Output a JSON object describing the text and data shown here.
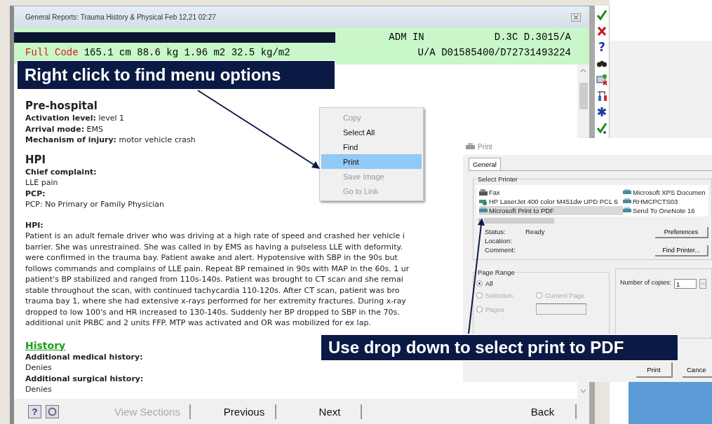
{
  "window": {
    "title": "General Reports:  Trauma History & Physical  Feb 12,21 02:27"
  },
  "banner": {
    "admission": "ADM IN",
    "location": "D.3C D.3015/A",
    "code_status": "Full Code",
    "measurements": "165.1 cm 88.6 kg  1.96 m2  32.5 kg/m2",
    "account": "U/A D01585400/D72731493224"
  },
  "callouts": [
    "Right click to find menu options",
    "Use drop down to select print to PDF"
  ],
  "report": [
    {
      "kind": "heading",
      "text": "Pre-hospital"
    },
    {
      "kind": "text",
      "text": "**Activation level:** level 1"
    },
    {
      "kind": "text",
      "text": "**Arrival mode:** EMS"
    },
    {
      "kind": "text",
      "text": "**Mechanism of injury:** motor vehicle crash"
    },
    {
      "kind": "heading",
      "text": "HPI"
    },
    {
      "kind": "label",
      "text": "Chief complaint:"
    },
    {
      "kind": "text",
      "text": "LLE pain"
    },
    {
      "kind": "label",
      "text": "PCP:"
    },
    {
      "kind": "text",
      "text": "PCP: No Primary or Family Physician"
    },
    {
      "kind": "label",
      "text": "HPI:"
    },
    {
      "kind": "paragraph",
      "lines": [
        "Patient is an adult female driver who was driving at a high rate of speed and crashed her vehicle i",
        "barrier. She was unrestrained. She was called in by EMS as having a pulseless LLE with deformity.",
        "were confirmed in the trauma bay. Patient awake and alert. Hypotensive with SBP in the 90s but",
        "follows commands and complains of LLE pain. Repeat BP remained in 90s with MAP in the 60s. 1 ur",
        "patient's BP stabilized and ranged from 110s-140s. Patient was brought to CT scan and she remai",
        "stable throughout the scan, with continued tachycardia 110-120s. After CT scan, patient was bro",
        "trauma bay 1, where she had extensive x-rays performed for her extremity fractures. During x-ray",
        "dropped to low 100's and HR increased to 130-140s. Suddenly her BP dropped to SBP in the 70s.",
        "additional unit PRBC and 2 units FFP. MTP was activated and OR was mobilized for ex lap."
      ]
    },
    {
      "kind": "link",
      "text": "History"
    },
    {
      "kind": "label",
      "text": "Additional medical history:"
    },
    {
      "kind": "text",
      "text": "Denies"
    },
    {
      "kind": "label",
      "text": "Additional surgical history:"
    },
    {
      "kind": "text",
      "text": "Denies"
    }
  ],
  "footer": {
    "help": "?",
    "buttons": [
      {
        "label": "View Sections",
        "disabled": true
      },
      {
        "label": "Previous",
        "disabled": false
      },
      {
        "label": "Next",
        "disabled": false
      }
    ],
    "back": "Back"
  },
  "toolbar": {
    "help": "?"
  },
  "context_menu": [
    {
      "label": "Copy",
      "disabled": true,
      "selected": false
    },
    {
      "label": "Select All",
      "disabled": false,
      "selected": false
    },
    {
      "label": "Find",
      "disabled": false,
      "selected": false
    },
    {
      "label": "Print",
      "disabled": false,
      "selected": true
    },
    {
      "label": "Save Image",
      "disabled": true,
      "selected": false
    },
    {
      "label": "Go to Link",
      "disabled": true,
      "selected": false
    }
  ],
  "print_dialog": {
    "title": "Print",
    "tabs": [
      {
        "label": "General",
        "selected": true
      }
    ],
    "printer_group": "Select Printer",
    "printers": [
      {
        "name": "Fax",
        "kind": "fax",
        "selected": false
      },
      {
        "name": "HP LaserJet 400 color M451dw UPD PCL 6",
        "kind": "default",
        "selected": false
      },
      {
        "name": "Microsoft Print to PDF",
        "kind": "printer",
        "selected": true
      },
      {
        "name": "Microsoft XPS Documen",
        "kind": "printer",
        "selected": false
      },
      {
        "name": "RHMCPCTS03",
        "kind": "printer",
        "selected": false
      },
      {
        "name": "Send To OneNote 16",
        "kind": "printer",
        "selected": false
      }
    ],
    "status": [
      {
        "label": "Status:",
        "value": "Ready"
      },
      {
        "label": "Location:"
      },
      {
        "label": "Comment:"
      }
    ],
    "side_buttons": [
      "Preferences",
      "Find Printer..."
    ],
    "page_range": {
      "title": "Page Range",
      "options": [
        {
          "label": "All",
          "selected": true,
          "disabled": false
        },
        {
          "label": "Selection",
          "selected": false,
          "disabled": true
        },
        {
          "label": "Current Page",
          "selected": false,
          "disabled": true
        },
        {
          "label": "Pages",
          "selected": false,
          "disabled": true
        }
      ]
    },
    "copies": {
      "label": "Number of copies:",
      "value": "1"
    },
    "buttons": [
      "Print",
      "Cance"
    ]
  }
}
